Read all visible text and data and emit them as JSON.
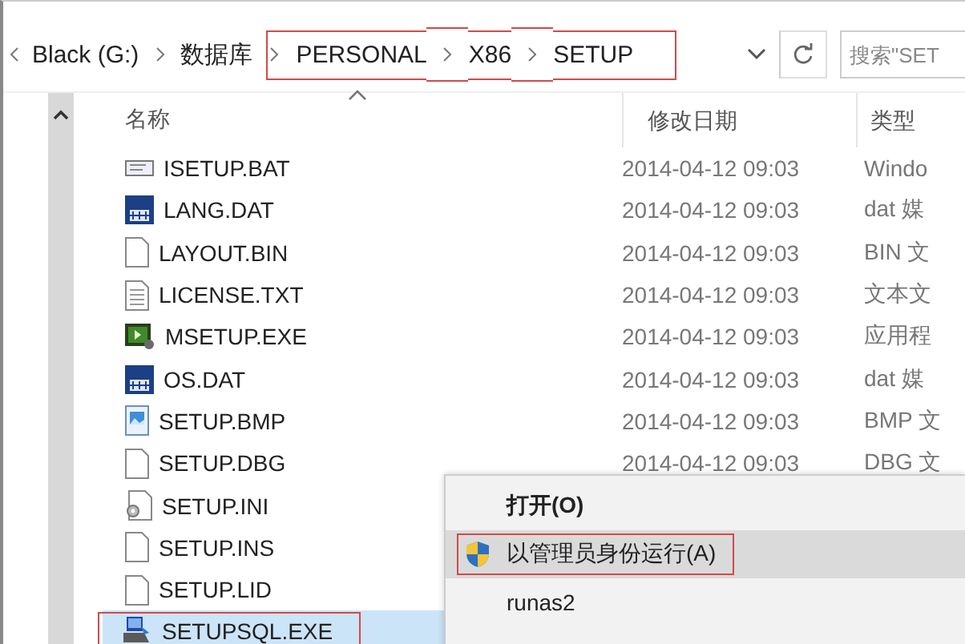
{
  "address_bar": {
    "crumbs": [
      {
        "label": "Black (G:)",
        "outlined": false
      },
      {
        "label": "数据库",
        "outlined": false
      },
      {
        "label": "PERSONAL",
        "outlined": true
      },
      {
        "label": "X86",
        "outlined": true
      },
      {
        "label": "SETUP",
        "outlined": true
      }
    ]
  },
  "search": {
    "placeholder": "搜索\"SET"
  },
  "columns": [
    "名称",
    "修改日期",
    "类型"
  ],
  "files": [
    {
      "name": "ISETUP.BAT",
      "date": "2014-04-12 09:03",
      "type": "Windo",
      "kind": "script",
      "selected": false,
      "outlined": false
    },
    {
      "name": "LANG.DAT",
      "date": "2014-04-12 09:03",
      "type": "dat 媒",
      "kind": "dat",
      "selected": false,
      "outlined": false
    },
    {
      "name": "LAYOUT.BIN",
      "date": "2014-04-12 09:03",
      "type": "BIN 文",
      "kind": "blank",
      "selected": false,
      "outlined": false
    },
    {
      "name": "LICENSE.TXT",
      "date": "2014-04-12 09:03",
      "type": "文本文",
      "kind": "text",
      "selected": false,
      "outlined": false
    },
    {
      "name": "MSETUP.EXE",
      "date": "2014-04-12 09:03",
      "type": "应用程",
      "kind": "exe",
      "selected": false,
      "outlined": false
    },
    {
      "name": "OS.DAT",
      "date": "2014-04-12 09:03",
      "type": "dat 媒",
      "kind": "dat",
      "selected": false,
      "outlined": false
    },
    {
      "name": "SETUP.BMP",
      "date": "2014-04-12 09:03",
      "type": "BMP 文",
      "kind": "image",
      "selected": false,
      "outlined": false
    },
    {
      "name": "SETUP.DBG",
      "date": "2014-04-12 09:03",
      "type": "DBG 文",
      "kind": "blank",
      "selected": false,
      "outlined": false
    },
    {
      "name": "SETUP.INI",
      "kind": "settings",
      "selected": false,
      "outlined": false
    },
    {
      "name": "SETUP.INS",
      "kind": "blank",
      "selected": false,
      "outlined": false
    },
    {
      "name": "SETUP.LID",
      "kind": "blank",
      "selected": false,
      "outlined": false
    },
    {
      "name": "SETUPSQL.EXE",
      "kind": "installer",
      "selected": true,
      "outlined": true
    }
  ],
  "context_menu": [
    {
      "label": "打开(O)",
      "kind": "default",
      "outlined": false,
      "hovered": false
    },
    {
      "label": "以管理员身份运行(A)",
      "kind": "shield",
      "outlined": true,
      "hovered": true
    },
    {
      "label": "runas2",
      "kind": "plain",
      "outlined": false,
      "hovered": false
    }
  ]
}
